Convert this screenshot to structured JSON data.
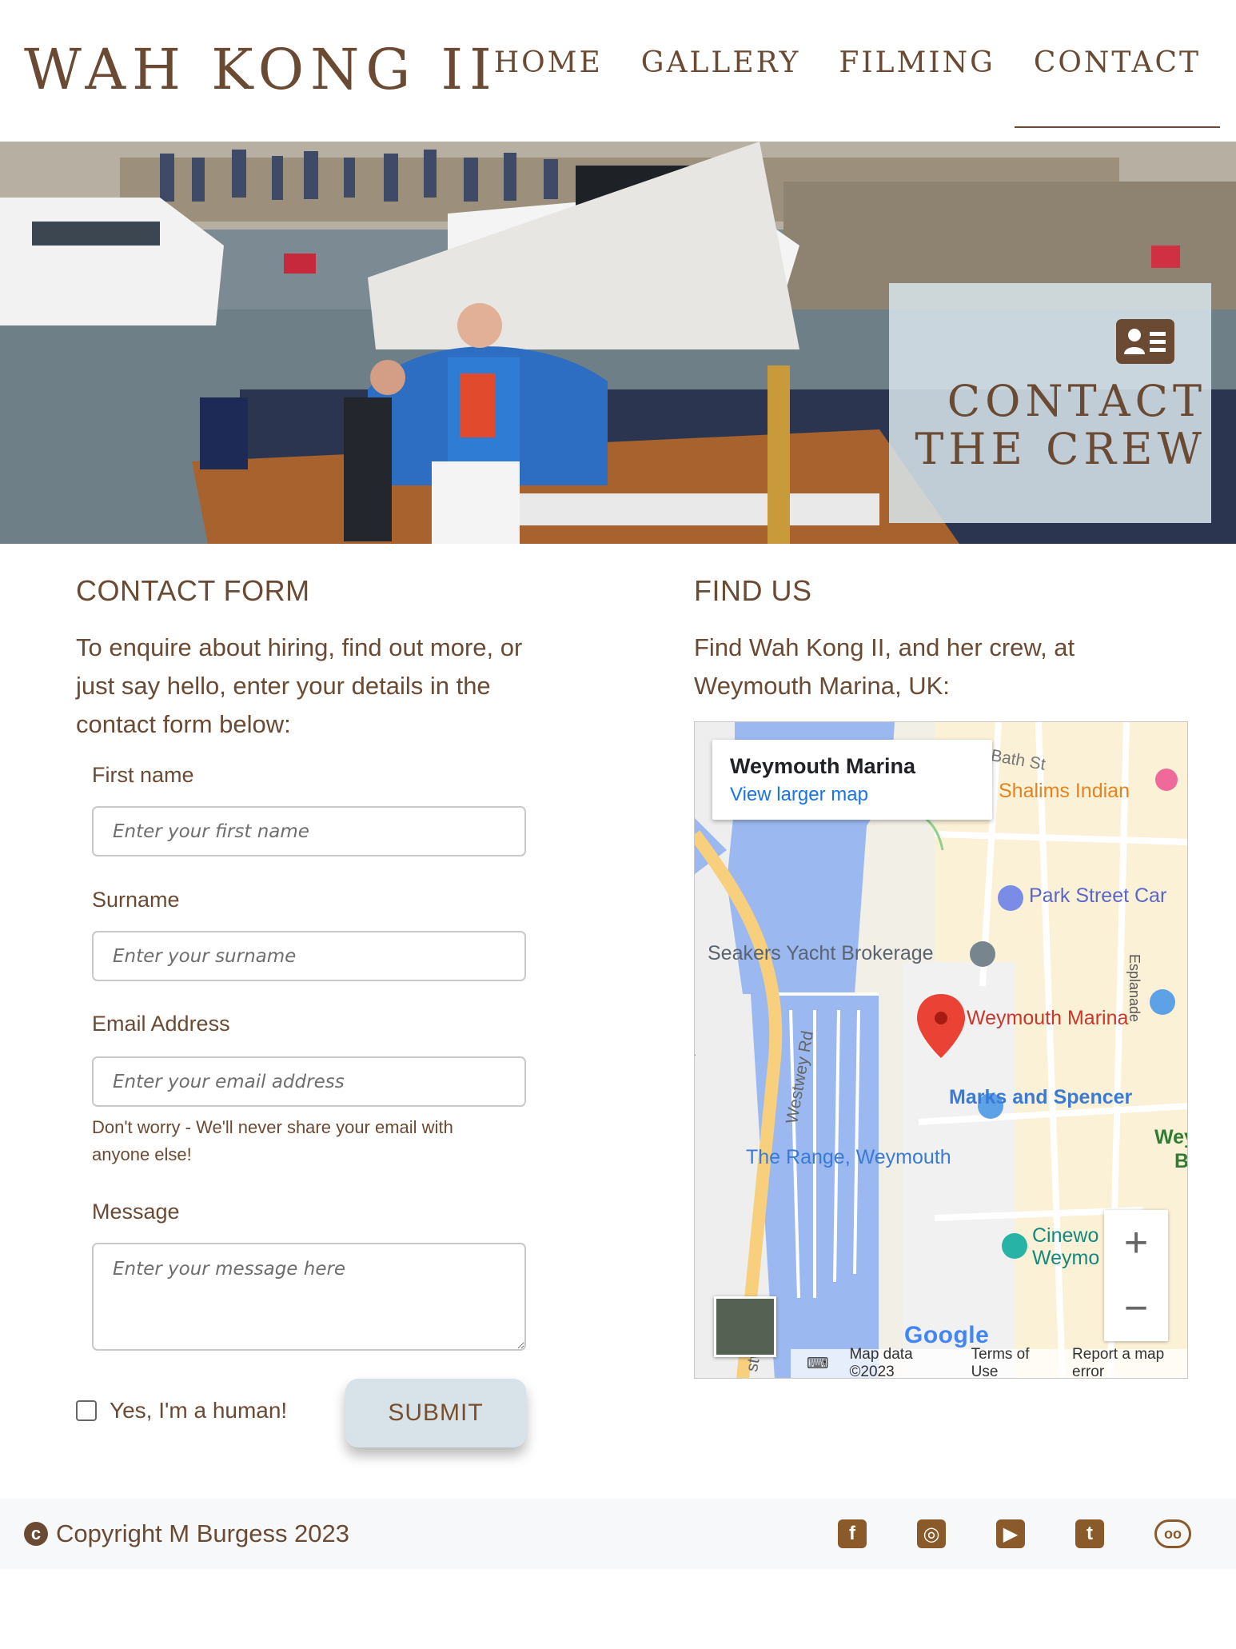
{
  "header": {
    "brand": "WAH KONG II",
    "nav": [
      {
        "label": "HOME"
      },
      {
        "label": "GALLERY"
      },
      {
        "label": "FILMING"
      },
      {
        "label": "CONTACT"
      }
    ]
  },
  "hero": {
    "title_line1": "CONTACT",
    "title_line2": "THE CREW",
    "card_icon": "contact-card-icon"
  },
  "contact_form": {
    "heading": "CONTACT FORM",
    "intro": "To enquire about hiring, find out more, or just say hello, enter your details in the contact form below:",
    "first_name_label": "First name",
    "first_name_placeholder": "Enter your first name",
    "surname_label": "Surname",
    "surname_placeholder": "Enter your surname",
    "email_label": "Email Address",
    "email_placeholder": "Enter your email address",
    "email_help": "Don't worry - We'll never share your email with anyone else!",
    "message_label": "Message",
    "message_placeholder": "Enter your message here",
    "human_label": "Yes, I'm a human!",
    "submit_label": "SUBMIT"
  },
  "find_us": {
    "heading": "FIND US",
    "intro": "Find Wah Kong II, and her crew, at Weymouth Marina, UK:",
    "map": {
      "popup_title": "Weymouth Marina",
      "popup_link": "View larger map",
      "labels": {
        "bath_st": "Bath St",
        "shalims": "Shalims Indian",
        "park_street": "Park Street Car",
        "seakers": "Seakers Yacht Brokerage",
        "esplanade": "Esplanade",
        "westwey_rd": "Westwey Rd",
        "westwey_rd_2": "stwey Rd",
        "weymouth_marina": "Weymouth Marina",
        "marks_spencer": "Marks and Spencer",
        "the_range": "The Range, Weymouth",
        "weym": "Weym",
        "b": "B",
        "cinewo": "Cinewo",
        "weymo": "Weymo",
        "rd_edge": "Rd"
      },
      "zoom_in": "+",
      "zoom_out": "−",
      "google": "Google",
      "map_data": "Map data ©2023",
      "terms": "Terms of Use",
      "report": "Report a map error"
    }
  },
  "footer": {
    "copyright": "Copyright M Burgess 2023",
    "socials": [
      {
        "icon": "facebook-icon",
        "glyph": "f"
      },
      {
        "icon": "instagram-icon",
        "glyph": "◎"
      },
      {
        "icon": "youtube-icon",
        "glyph": "▶"
      },
      {
        "icon": "twitter-icon",
        "glyph": "t"
      },
      {
        "icon": "tripadvisor-icon",
        "glyph": "oo"
      }
    ]
  },
  "colors": {
    "brand_brown": "#6b4a34",
    "button_bg": "#d7e3e9",
    "link_blue": "#1a73e8",
    "map_water": "#9bb8f0",
    "map_pin": "#ea4335"
  }
}
